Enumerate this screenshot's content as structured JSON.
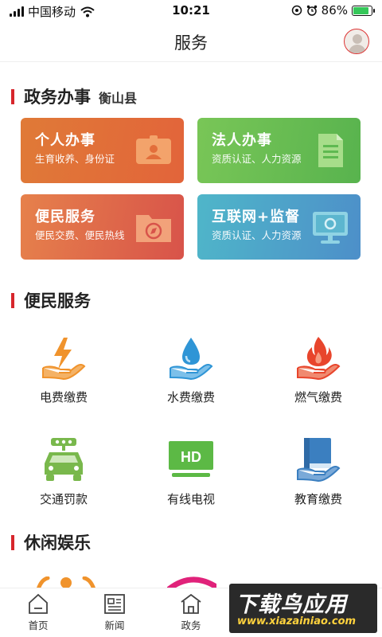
{
  "status_bar": {
    "carrier": "中国移动",
    "time": "10:21",
    "battery_text": "86%",
    "battery_level": 0.86
  },
  "nav": {
    "title": "服务"
  },
  "gov_section": {
    "title": "政务办事",
    "location": "衡山县",
    "cards": [
      {
        "title": "个人办事",
        "desc": "生育收养、身份证",
        "icon": "id-card-icon"
      },
      {
        "title": "法人办事",
        "desc": "资质认证、人力资源",
        "icon": "document-icon"
      },
      {
        "title": "便民服务",
        "desc": "便民交费、便民热线",
        "icon": "folder-compass-icon"
      },
      {
        "title": "互联网+监督",
        "desc": "资质认证、人力资源",
        "icon": "monitor-icon"
      }
    ]
  },
  "convenience_section": {
    "title": "便民服务",
    "items": [
      {
        "label": "电费缴费",
        "icon": "electricity-icon"
      },
      {
        "label": "水费缴费",
        "icon": "water-icon"
      },
      {
        "label": "燃气缴费",
        "icon": "gas-flame-icon"
      },
      {
        "label": "交通罚款",
        "icon": "car-icon"
      },
      {
        "label": "有线电视",
        "icon": "hd-tv-icon",
        "badge": "HD"
      },
      {
        "label": "教育缴费",
        "icon": "book-icon"
      }
    ]
  },
  "leisure_section": {
    "title": "休闲娱乐"
  },
  "tab_bar": {
    "tabs": [
      {
        "label": "首页",
        "icon": "home-icon"
      },
      {
        "label": "新闻",
        "icon": "news-icon"
      },
      {
        "label": "政务",
        "icon": "gov-icon"
      }
    ]
  },
  "watermark": {
    "text": "下载鸟应用",
    "url": "www.xiazainiao.com"
  },
  "colors": {
    "accent_red": "#d7262c",
    "card_orange": "#e07a37",
    "card_green": "#5fb951",
    "card_red": "#dc5f49",
    "card_blue": "#4da3c9",
    "icon_orange": "#f0932c",
    "icon_blue": "#2f95d6",
    "icon_red": "#e8452c",
    "icon_green": "#79b84c"
  }
}
